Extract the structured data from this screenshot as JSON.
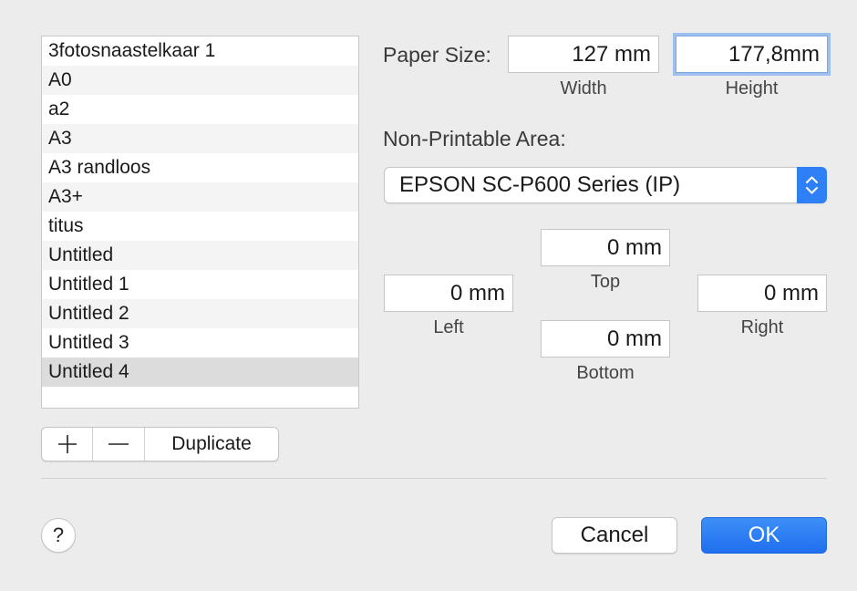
{
  "paper_sizes": [
    "3fotosnaastelkaar 1",
    "A0",
    "a2",
    "A3",
    "A3 randloos",
    "A3+",
    "titus",
    "Untitled",
    "Untitled 1",
    "Untitled 2",
    "Untitled 3",
    "Untitled 4"
  ],
  "selected_index": 11,
  "list_buttons": {
    "add_label": "+",
    "remove_label": "—",
    "duplicate_label": "Duplicate"
  },
  "paper_size": {
    "label": "Paper Size:",
    "width_value": "127 mm",
    "width_caption": "Width",
    "height_value": "177,8mm",
    "height_caption": "Height"
  },
  "non_printable": {
    "label": "Non-Printable Area:",
    "printer": "EPSON SC-P600 Series (IP)",
    "top_value": "0 mm",
    "top_caption": "Top",
    "left_value": "0 mm",
    "left_caption": "Left",
    "right_value": "0 mm",
    "right_caption": "Right",
    "bottom_value": "0 mm",
    "bottom_caption": "Bottom"
  },
  "footer": {
    "help_label": "?",
    "cancel_label": "Cancel",
    "ok_label": "OK"
  },
  "colors": {
    "accent": "#2f7ff6",
    "background": "#ececec"
  }
}
